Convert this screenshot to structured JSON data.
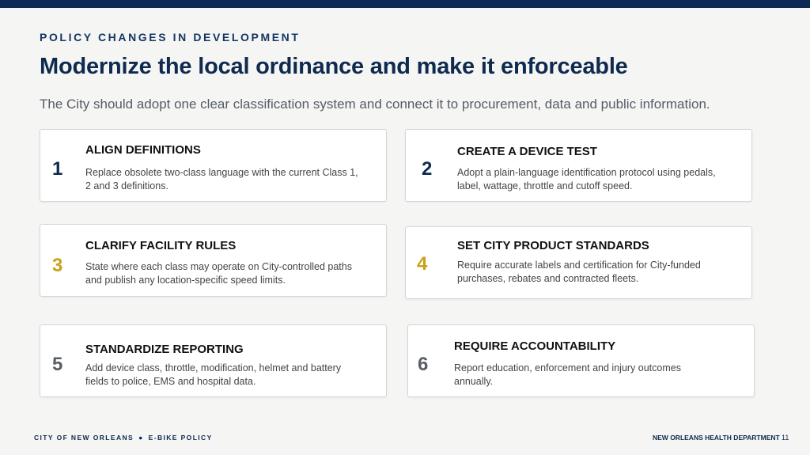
{
  "header": {
    "eyebrow": "POLICY CHANGES IN DEVELOPMENT",
    "title": "Modernize the local ordinance and make it enforceable",
    "subtitle": "The City should adopt one clear classification system and connect it to procurement, data and public information."
  },
  "colors": {
    "navy": "#0f2a4f",
    "gold": "#c8a21a",
    "gray": "#5a5f66"
  },
  "cards": [
    {
      "number": "1",
      "heading": "ALIGN DEFINITIONS",
      "description": "Replace obsolete two-class language with the current Class 1, 2 and 3 definitions."
    },
    {
      "number": "2",
      "heading": "CREATE A DEVICE TEST",
      "description": "Adopt a plain-language identification protocol using pedals, label, wattage, throttle and cutoff speed."
    },
    {
      "number": "3",
      "heading": "CLARIFY FACILITY RULES",
      "description": "State where each class may operate on City-controlled paths and publish any location-specific speed limits."
    },
    {
      "number": "4",
      "heading": "SET CITY PRODUCT STANDARDS",
      "description": "Require accurate labels and  certification for City-funded purchases, rebates and contracted fleets."
    },
    {
      "number": "5",
      "heading": "STANDARDIZE REPORTING",
      "description": "Add device class, throttle, modification, helmet and battery fields to police, EMS and hospital data."
    },
    {
      "number": "6",
      "heading": "REQUIRE ACCOUNTABILITY",
      "description": "Report education, enforcement and injury outcomes annually."
    }
  ],
  "footer": {
    "left_a": "CITY OF NEW ORLEANS",
    "separator": "●",
    "left_b": "E-BIKE POLICY",
    "right": "NEW ORLEANS HEALTH DEPARTMENT",
    "page": "11"
  }
}
